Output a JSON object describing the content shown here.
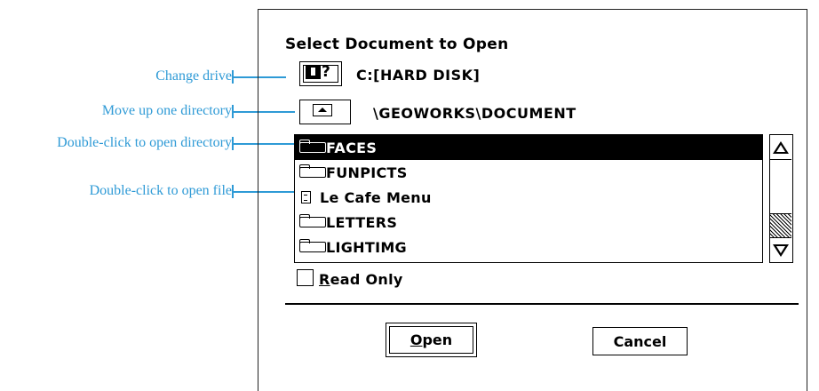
{
  "callouts": {
    "change_drive": "Change drive",
    "move_up": "Move up one directory",
    "open_directory": "Double-click to open directory",
    "open_file": "Double-click to open file"
  },
  "dialog": {
    "title": "Select Document to Open",
    "drive_icon": "drive-icon",
    "drive_label": "C:[HARD DISK]",
    "up_icon": "up-directory-icon",
    "path": "\\GEOWORKS\\DOCUMENT",
    "files": [
      {
        "name": "FACES",
        "kind": "folder",
        "selected": true
      },
      {
        "name": "FUNPICTS",
        "kind": "folder",
        "selected": false
      },
      {
        "name": "Le Cafe Menu",
        "kind": "document",
        "selected": false
      },
      {
        "name": "LETTERS",
        "kind": "folder",
        "selected": false
      },
      {
        "name": "LIGHTIMG",
        "kind": "folder",
        "selected": false
      }
    ],
    "read_only_label_first": "R",
    "read_only_label_rest": "ead Only",
    "read_only_checked": false,
    "open_label_first": "O",
    "open_label_rest": "pen",
    "cancel_label": "Cancel"
  },
  "colors": {
    "callout": "#2e9ad6"
  }
}
